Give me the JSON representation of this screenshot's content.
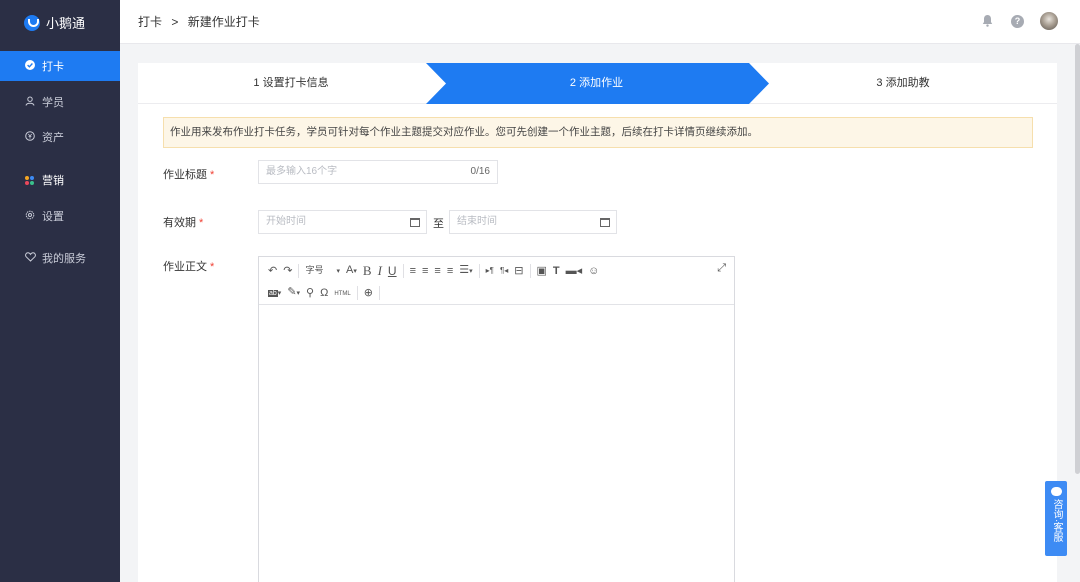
{
  "app": {
    "name": "小鹅通"
  },
  "sidebar": {
    "items": [
      {
        "label": "打卡",
        "icon": "check-circle-icon"
      },
      {
        "label": "学员",
        "icon": "user-icon"
      },
      {
        "label": "资产",
        "icon": "asset-icon"
      },
      {
        "label": "营销",
        "icon": "marketing-dots-icon"
      },
      {
        "label": "设置",
        "icon": "gear-icon"
      },
      {
        "label": "我的服务",
        "icon": "heart-icon"
      }
    ]
  },
  "header": {
    "breadcrumb": [
      "打卡",
      "新建作业打卡"
    ],
    "separator": ">"
  },
  "steps": [
    {
      "label": "1 设置打卡信息",
      "active": false
    },
    {
      "label": "2 添加作业",
      "active": true
    },
    {
      "label": "3 添加助教",
      "active": false
    }
  ],
  "colors": {
    "accent": "#1e7bf2",
    "sidebar_bg": "#2b2f45",
    "required": "#f04134",
    "notice_bg": "#fdf6e7"
  },
  "form": {
    "notice": "作业用来发布作业打卡任务，学员可针对每个作业主题提交对应作业。您可先创建一个作业主题，后续在打卡详情页继续添加。",
    "title_label": "作业标题",
    "title_placeholder": "最多输入16个字",
    "title_counter": "0/16",
    "validity_label": "有效期",
    "start_placeholder": "开始时间",
    "range_to": "至",
    "end_placeholder": "结束时间",
    "content_label": "作业正文",
    "required_mark": "*"
  },
  "editor": {
    "font_size_label": "字号",
    "html_label": "HTML"
  },
  "consult": {
    "label": "咨询·客服"
  }
}
